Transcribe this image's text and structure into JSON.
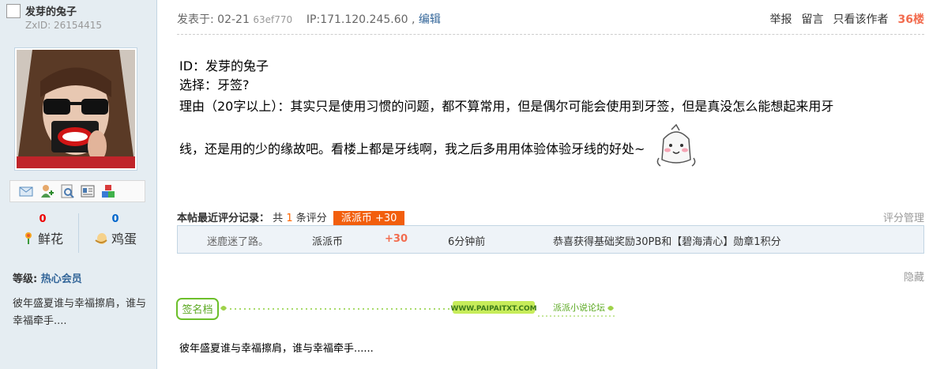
{
  "author": {
    "name": "发芽的兔子",
    "zxid": "ZxID:  26154415",
    "level_label": "等级:",
    "level_value": "热心会员",
    "stats": {
      "flowers_count": "0",
      "flowers_label": "鲜花",
      "eggs_count": "0",
      "eggs_label": "鸡蛋"
    },
    "signature_side": "彼年盛夏谁与幸福擦肩，谁与幸福牵手...."
  },
  "tool_icons": [
    "mail-icon",
    "add-friend-icon",
    "profile-icon",
    "card-icon",
    "blocks-icon"
  ],
  "post": {
    "posted_label": "发表于: 02-21",
    "hash": "63ef770",
    "ip": "IP:171.120.245.60 ,",
    "edit": "编辑",
    "actions": {
      "report": "举报",
      "comment": "留言",
      "author_only": "只看该作者",
      "floor": "36楼"
    },
    "content": {
      "line1": "ID：发芽的兔子",
      "line2": "选择：牙签?",
      "line3": "理由（20字以上）：其实只是使用习惯的问题，都不算常用，但是偶尔可能会使用到牙签，但是真没怎么能想起来用牙",
      "line4": "线，还是用的少的缘故吧。看楼上都是牙线啊，我之后多用用体验体验牙线的好处~"
    }
  },
  "rating": {
    "title": "本帖最近评分记录：",
    "count_prefix": "共",
    "count": "1",
    "count_suffix": "条评分",
    "badge": "派派币 +30",
    "manage": "评分管理",
    "rows": [
      {
        "user": "迷鹿迷了路。",
        "kind": "派派币",
        "score": "+30",
        "time": "6分钟前",
        "reason": "恭喜获得基础奖励30PB和【碧海清心】勋章1积分"
      }
    ]
  },
  "hide": "隐藏",
  "signature": {
    "tag": "签名档",
    "site": "WWW.PAIPAITXT.COM",
    "forum": "派派小说论坛",
    "text": "彼年盛夏谁与幸福擦肩，谁与幸福牵手......"
  }
}
